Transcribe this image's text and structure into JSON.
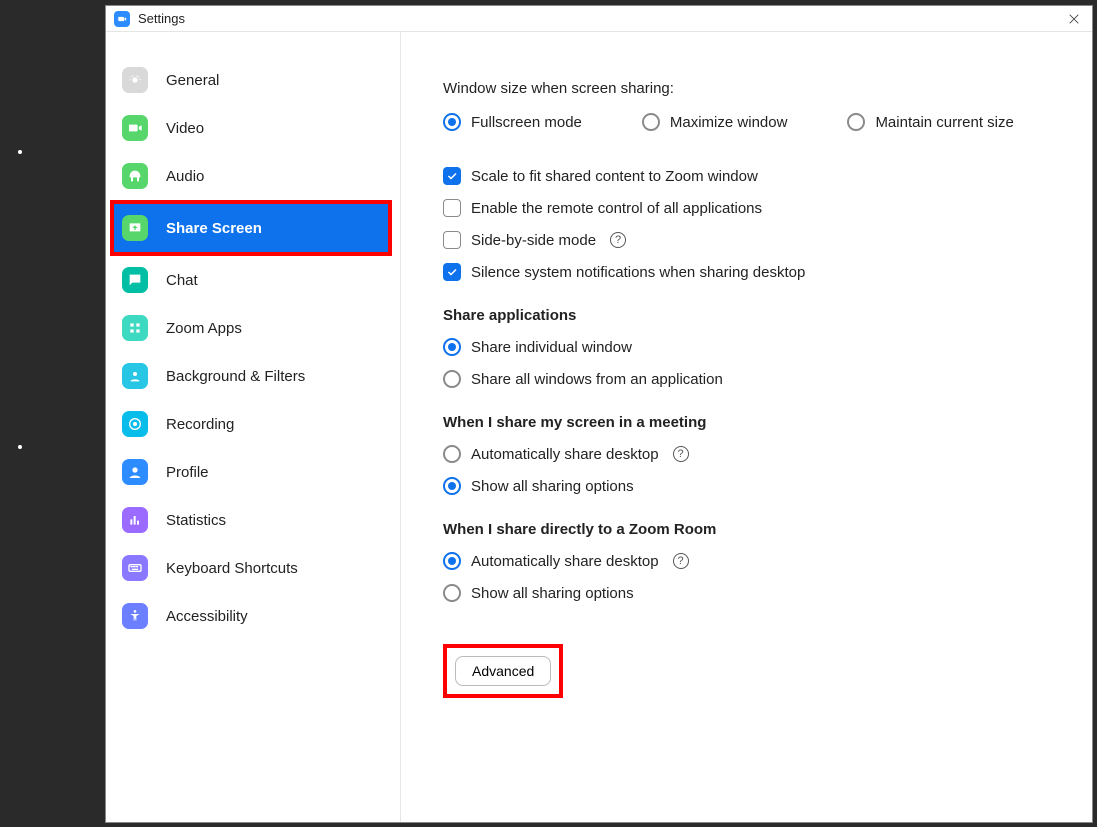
{
  "window": {
    "title": "Settings"
  },
  "sidebar": {
    "items": [
      {
        "id": "general",
        "label": "General"
      },
      {
        "id": "video",
        "label": "Video"
      },
      {
        "id": "audio",
        "label": "Audio"
      },
      {
        "id": "share",
        "label": "Share Screen"
      },
      {
        "id": "chat",
        "label": "Chat"
      },
      {
        "id": "zoomapps",
        "label": "Zoom Apps"
      },
      {
        "id": "bgfilters",
        "label": "Background & Filters"
      },
      {
        "id": "recording",
        "label": "Recording"
      },
      {
        "id": "profile",
        "label": "Profile"
      },
      {
        "id": "stats",
        "label": "Statistics"
      },
      {
        "id": "keyboard",
        "label": "Keyboard Shortcuts"
      },
      {
        "id": "access",
        "label": "Accessibility"
      }
    ]
  },
  "main": {
    "windowSize": {
      "title": "Window size when screen sharing:",
      "options": {
        "fullscreen": "Fullscreen mode",
        "maximize": "Maximize window",
        "maintain": "Maintain current size"
      },
      "selected": "fullscreen"
    },
    "checkboxes": {
      "scale": {
        "label": "Scale to fit shared content to Zoom window",
        "checked": true
      },
      "remote": {
        "label": "Enable the remote control of all applications",
        "checked": false
      },
      "sbs": {
        "label": "Side-by-side mode",
        "checked": false,
        "help": true
      },
      "silence": {
        "label": "Silence system notifications when sharing desktop",
        "checked": true
      }
    },
    "shareApps": {
      "title": "Share applications",
      "options": {
        "individual": "Share individual window",
        "all": "Share all windows from an application"
      },
      "selected": "individual"
    },
    "meeting": {
      "title": "When I share my screen in a meeting",
      "options": {
        "auto": "Automatically share desktop",
        "show": "Show all sharing options"
      },
      "selected": "show",
      "help_on": "auto"
    },
    "zoomRoom": {
      "title": "When I share directly to a Zoom Room",
      "options": {
        "auto": "Automatically share desktop",
        "show": "Show all sharing options"
      },
      "selected": "auto",
      "help_on": "auto"
    },
    "advanced": "Advanced"
  }
}
